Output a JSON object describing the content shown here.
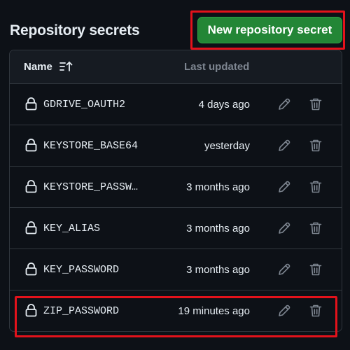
{
  "header": {
    "title": "Repository secrets",
    "new_button_label": "New repository secret"
  },
  "table": {
    "columns": {
      "name": "Name",
      "last_updated": "Last updated"
    },
    "rows": [
      {
        "name": "GDRIVE_OAUTH2",
        "updated": "4 days ago"
      },
      {
        "name": "KEYSTORE_BASE64",
        "updated": "yesterday"
      },
      {
        "name": "KEYSTORE_PASSW…",
        "updated": "3 months ago"
      },
      {
        "name": "KEY_ALIAS",
        "updated": "3 months ago"
      },
      {
        "name": "KEY_PASSWORD",
        "updated": "3 months ago"
      },
      {
        "name": "ZIP_PASSWORD",
        "updated": "19 minutes ago"
      }
    ]
  },
  "icons": {
    "lock": "lock-icon",
    "edit": "pencil-icon",
    "delete": "trash-icon",
    "sort": "sort-ascending-icon"
  },
  "colors": {
    "background": "#0d1117",
    "header_bg": "#161b22",
    "border": "#30363d",
    "primary_button": "#238636",
    "highlight": "#e3121b",
    "muted_text": "#7d8590"
  }
}
